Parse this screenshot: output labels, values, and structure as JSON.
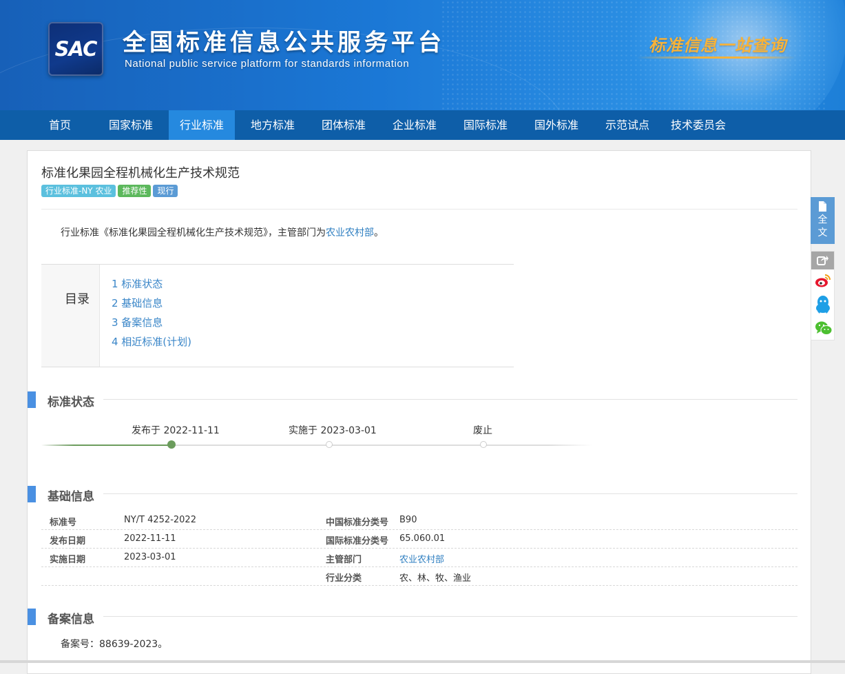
{
  "header": {
    "logo_text": "SAC",
    "title": "全国标准信息公共服务平台",
    "subtitle": "National public service platform  for standards information",
    "slogan": "标准信息一站查询"
  },
  "nav": {
    "items": [
      {
        "label": "首页"
      },
      {
        "label": "国家标准"
      },
      {
        "label": "行业标准"
      },
      {
        "label": "地方标准"
      },
      {
        "label": "团体标准"
      },
      {
        "label": "企业标准"
      },
      {
        "label": "国际标准"
      },
      {
        "label": "国外标准"
      },
      {
        "label": "示范试点"
      },
      {
        "label": "技术委员会"
      }
    ],
    "active": "行业标准"
  },
  "standard": {
    "title": "标准化果园全程机械化生产技术规范",
    "tags": [
      "行业标准-NY 农业",
      "推荐性",
      "现行"
    ],
    "summary_prefix": "行业标准《标准化果园全程机械化生产技术规范》，主管部门为",
    "summary_link": "农业农村部",
    "summary_suffix": "。"
  },
  "toc": {
    "label": "目录",
    "items": [
      "1  标准状态",
      "2  基础信息",
      "3  备案信息",
      "4  相近标准(计划)"
    ]
  },
  "sections": {
    "status": "标准状态",
    "basic": "基础信息",
    "record": "备案信息"
  },
  "timeline": {
    "published": "发布于 2022-11-11",
    "implemented": "实施于 2023-03-01",
    "abolished": "废止",
    "current_stage": "published"
  },
  "basic_info": {
    "std_no_label": "标准号",
    "std_no": "NY/T 4252-2022",
    "ccs_label": "中国标准分类号",
    "ccs": "B90",
    "pub_date_label": "发布日期",
    "pub_date": "2022-11-11",
    "ics_label": "国际标准分类号",
    "ics": "65.060.01",
    "impl_date_label": "实施日期",
    "impl_date": "2023-03-01",
    "dept_label": "主管部门",
    "dept": "农业农村部",
    "industry_label": "行业分类",
    "industry": "农、林、牧、渔业"
  },
  "record_info": {
    "text": "备案号：88639-2023。"
  },
  "sidebar": {
    "fulltext_label_1": "全",
    "fulltext_label_2": "文",
    "share_icons": [
      "share-icon",
      "weibo-icon",
      "qq-icon",
      "wechat-icon"
    ]
  },
  "colors": {
    "banner": "#1b78d6",
    "nav": "#0e5ea8",
    "nav_active": "#2589df",
    "tag_industry": "#5bc0de",
    "tag_recommended": "#5cb85c",
    "tag_current": "#5b9bd5",
    "section_bar": "#4a90e2",
    "link": "#2f7fc1",
    "timeline_done": "#6b9c5c"
  }
}
